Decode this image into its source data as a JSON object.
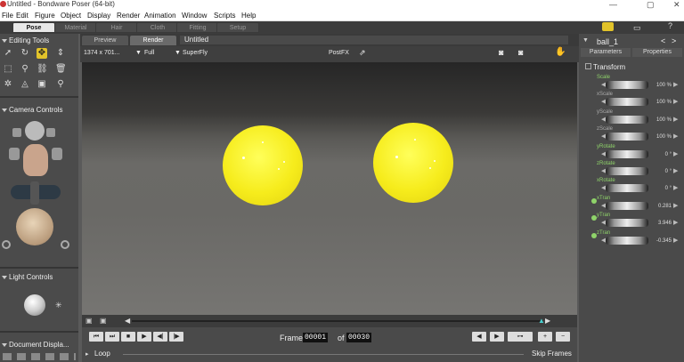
{
  "window": {
    "title": "Untitled - Bondware Poser (64-bit)",
    "min": "—",
    "restore": "▢",
    "close": "✕"
  },
  "menu": [
    "File",
    "Edit",
    "Figure",
    "Object",
    "Display",
    "Render",
    "Animation",
    "Window",
    "Scripts",
    "Help"
  ],
  "rooms": [
    "Pose",
    "Material",
    "Hair",
    "Cloth",
    "Fitting",
    "Setup"
  ],
  "left": {
    "editing_tools": "Editing Tools",
    "camera_controls": "Camera Controls",
    "light_controls": "Light Controls",
    "document_display": "Document Displa..."
  },
  "doc": {
    "tabs": [
      "Preview",
      "Render"
    ],
    "title": "Untitled",
    "size": "1374 x 701...",
    "scale": "Full",
    "renderer": "SuperFly",
    "postfx": "PostFX"
  },
  "timeline": {
    "frame_label": "Frame:",
    "frame": "00001",
    "of_label": "of",
    "total": "00030",
    "loop": "Loop",
    "skip": "Skip Frames"
  },
  "right": {
    "object": "ball_1",
    "tabs": [
      "Parameters",
      "Properties"
    ],
    "group": "Transform",
    "params": [
      {
        "label": "Scale",
        "value": "100 %",
        "keyed": true,
        "dot": false
      },
      {
        "label": "xScale",
        "value": "100 %",
        "keyed": false,
        "dot": false
      },
      {
        "label": "yScale",
        "value": "100 %",
        "keyed": false,
        "dot": false
      },
      {
        "label": "zScale",
        "value": "100 %",
        "keyed": false,
        "dot": false
      },
      {
        "label": "yRotate",
        "value": "0 °",
        "keyed": true,
        "dot": false
      },
      {
        "label": "zRotate",
        "value": "0 °",
        "keyed": true,
        "dot": false
      },
      {
        "label": "xRotate",
        "value": "0 °",
        "keyed": true,
        "dot": false
      },
      {
        "label": "xTran",
        "value": "0.281",
        "keyed": true,
        "dot": true
      },
      {
        "label": "yTran",
        "value": "3.946",
        "keyed": true,
        "dot": true
      },
      {
        "label": "zTran",
        "value": "-0.345",
        "keyed": true,
        "dot": true
      }
    ]
  },
  "colors": {
    "accent_tool": "#e2c32a",
    "ball": "#f6ec1c",
    "key": "#8fd36a"
  }
}
